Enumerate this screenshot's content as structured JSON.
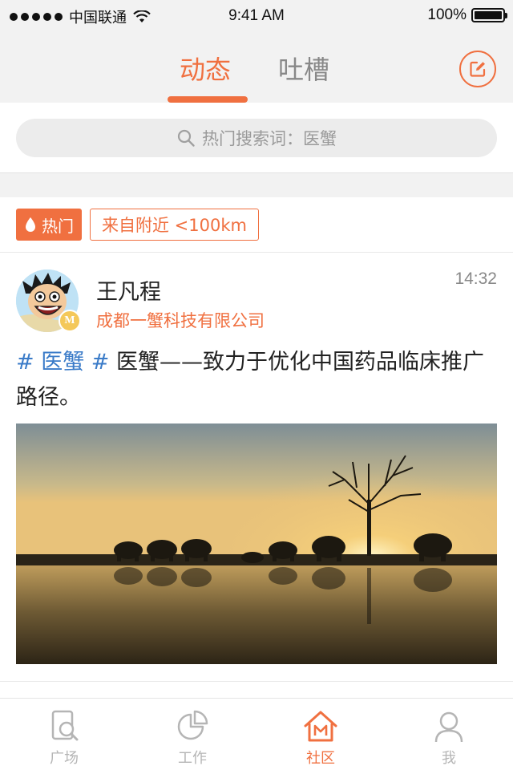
{
  "status_bar": {
    "carrier": "中国联通",
    "time": "9:41 AM",
    "battery": "100%",
    "battery_level": 1.0
  },
  "nav": {
    "tabs": [
      {
        "label": "动态",
        "active": true
      },
      {
        "label": "吐槽",
        "active": false
      }
    ],
    "compose_icon": "edit-icon"
  },
  "search": {
    "placeholder": "热门搜索词：医蟹",
    "icon": "search-icon"
  },
  "post": {
    "tags": {
      "hot": "热门",
      "nearby": "来自附近 <100km"
    },
    "user_name": "王凡程",
    "company": "成都一蟹科技有限公司",
    "time": "14:32",
    "avatar_badge": "M",
    "hashtag": "# 医蟹 #",
    "text": " 医蟹——致力于优化中国药品临床推广路径。",
    "image": "sunset-elephants-photo"
  },
  "tabbar": {
    "items": [
      {
        "label": "广场",
        "icon": "plaza-icon",
        "active": false
      },
      {
        "label": "工作",
        "icon": "work-chart-icon",
        "active": false
      },
      {
        "label": "社区",
        "icon": "community-home-icon",
        "active": true
      },
      {
        "label": "我",
        "icon": "profile-icon",
        "active": false
      }
    ]
  },
  "colors": {
    "accent": "#f07040",
    "hashtag": "#3a7bc8",
    "muted": "#888888"
  }
}
